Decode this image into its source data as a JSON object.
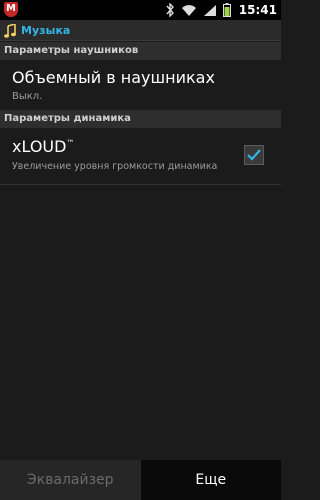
{
  "status_bar": {
    "time": "15:41",
    "icons": [
      "mcafee-icon",
      "bluetooth-icon",
      "wifi-icon",
      "signal-icon",
      "battery-icon"
    ]
  },
  "action_bar": {
    "title": "Музыка",
    "icon": "music-note-icon",
    "title_color": "#33b5e5"
  },
  "headphones_section": {
    "header": "Параметры наушников",
    "item": {
      "title": "Объемный в наушниках",
      "summary": "Выкл."
    }
  },
  "speaker_section": {
    "header": "Параметры динамика",
    "item": {
      "title": "xLOUD",
      "trademark": "™",
      "summary": "Увеличение уровня громкости динамика",
      "checked": true
    }
  },
  "bottom_bar": {
    "equalizer_label": "Эквалайзер",
    "more_label": "Еще"
  }
}
